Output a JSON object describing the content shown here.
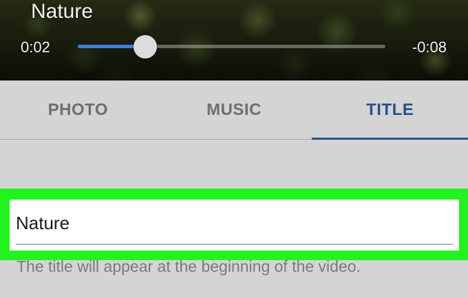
{
  "player": {
    "title": "Nature",
    "elapsed": "0:02",
    "remaining": "-0:08",
    "progress": 0.22
  },
  "tabs": [
    {
      "label": "PHOTO",
      "active": false
    },
    {
      "label": "MUSIC",
      "active": false
    },
    {
      "label": "TITLE",
      "active": true
    }
  ],
  "title_field": {
    "value": "Nature",
    "helper": "The title will appear at the beginning of the video."
  },
  "colors": {
    "accent": "#2b4e8c",
    "seek_fill": "#3f7fd8",
    "highlight": "#22f31f",
    "background": "#d4d4d4"
  }
}
